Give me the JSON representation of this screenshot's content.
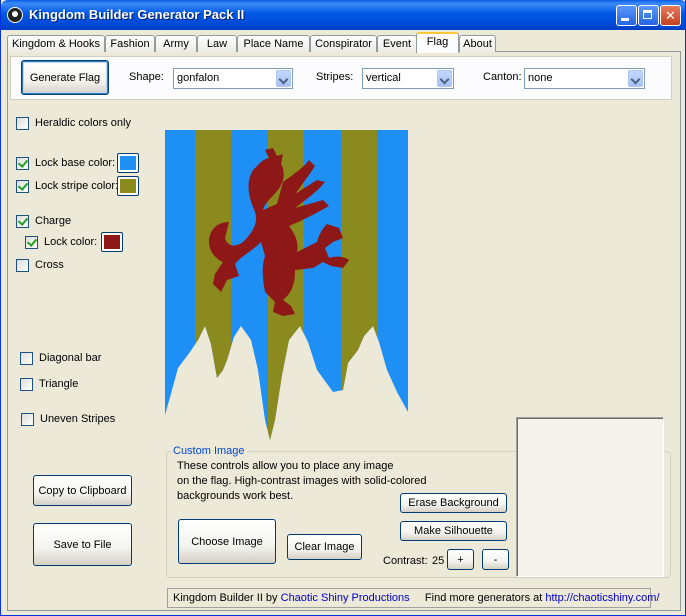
{
  "window": {
    "title": "Kingdom Builder Generator Pack II"
  },
  "tabs": [
    {
      "label": "Kingdom & Hooks"
    },
    {
      "label": "Fashion"
    },
    {
      "label": "Army"
    },
    {
      "label": "Law"
    },
    {
      "label": "Place Name"
    },
    {
      "label": "Conspirator"
    },
    {
      "label": "Event"
    },
    {
      "label": "Flag",
      "active": true
    },
    {
      "label": "About"
    }
  ],
  "toolbar": {
    "generate_label": "Generate Flag",
    "shape_label": "Shape:",
    "shape_value": "gonfalon",
    "stripes_label": "Stripes:",
    "stripes_value": "vertical",
    "canton_label": "Canton:",
    "canton_value": "none"
  },
  "options": {
    "heraldic": {
      "label": "Heraldic colors only",
      "checked": false
    },
    "lock_base": {
      "label": "Lock base color:",
      "checked": true,
      "color": "#1e8ff5"
    },
    "lock_stripe": {
      "label": "Lock stripe color:",
      "checked": true,
      "color": "#8a8a1e"
    },
    "charge": {
      "label": "Charge",
      "checked": true
    },
    "lock_charge": {
      "label": "Lock color:",
      "checked": true,
      "color": "#8e1717"
    },
    "cross": {
      "label": "Cross",
      "checked": false
    },
    "diagonal": {
      "label": "Diagonal bar",
      "checked": false
    },
    "triangle": {
      "label": "Triangle",
      "checked": false
    },
    "uneven": {
      "label": "Uneven Stripes",
      "checked": false
    }
  },
  "buttons": {
    "copy_label": "Copy to Clipboard",
    "save_label": "Save to File"
  },
  "flag": {
    "base_color": "#1e8ff5",
    "stripe_color": "#8a8a1e",
    "charge_color": "#8e1717",
    "charge_icon": "griffin-icon"
  },
  "custom_image": {
    "title": "Custom Image",
    "text_line1": "These controls allow you to place any image",
    "text_line2": "on the flag. High-contrast  images with solid-colored",
    "text_line3": "backgrounds work best.",
    "erase_label": "Erase Background",
    "silhouette_label": "Make Silhouette",
    "choose_label": "Choose Image",
    "clear_label": "Clear Image",
    "contrast_label": "Contrast:",
    "contrast_value": "25",
    "plus_label": "+",
    "minus_label": "-"
  },
  "status": {
    "prefix": "Kingdom Builder II by",
    "author_link": "Chaotic Shiny Productions",
    "more_text": "Find more generators at",
    "url_link": "http://chaoticshiny.com/"
  }
}
